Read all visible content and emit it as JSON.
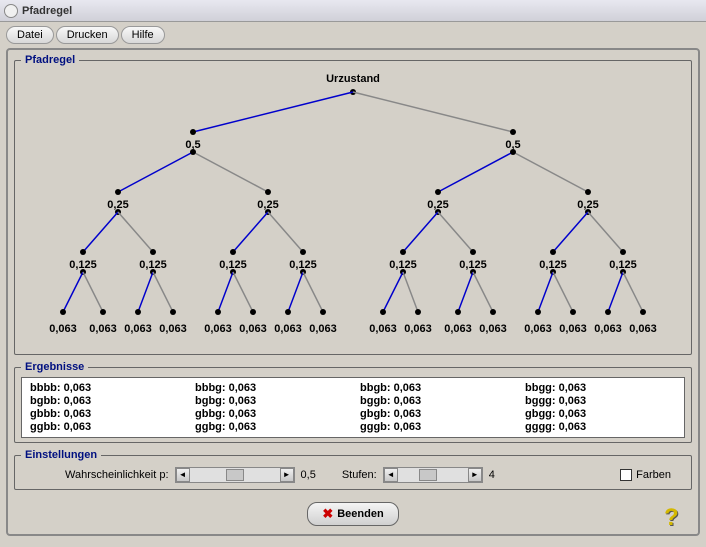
{
  "window": {
    "title": "Pfadregel"
  },
  "menu": {
    "datei": "Datei",
    "drucken": "Drucken",
    "hilfe": "Hilfe"
  },
  "frames": {
    "pfadregel": "Pfadregel",
    "ergebnisse": "Ergebnisse",
    "einstellungen": "Einstellungen"
  },
  "tree": {
    "root_label": "Urzustand",
    "level1": [
      "0,5",
      "0,5"
    ],
    "level2": [
      "0,25",
      "0,25",
      "0,25",
      "0,25"
    ],
    "level3": [
      "0,125",
      "0,125",
      "0,125",
      "0,125",
      "0,125",
      "0,125",
      "0,125",
      "0,125"
    ],
    "level4": [
      "0,063",
      "0,063",
      "0,063",
      "0,063",
      "0,063",
      "0,063",
      "0,063",
      "0,063",
      "0,063",
      "0,063",
      "0,063",
      "0,063",
      "0,063",
      "0,063",
      "0,063",
      "0,063"
    ]
  },
  "results": {
    "r0": "bbbb: 0,063",
    "r1": "bbbg: 0,063",
    "r2": "bbgb: 0,063",
    "r3": "bbgg: 0,063",
    "r4": "bgbb: 0,063",
    "r5": "bgbg: 0,063",
    "r6": "bggb: 0,063",
    "r7": "bggg: 0,063",
    "r8": "gbbb: 0,063",
    "r9": "gbbg: 0,063",
    "r10": "gbgb: 0,063",
    "r11": "gbgg: 0,063",
    "r12": "ggbb: 0,063",
    "r13": "ggbg: 0,063",
    "r14": "gggb: 0,063",
    "r15": "gggg: 0,063"
  },
  "settings": {
    "prob_label": "Wahrscheinlichkeit p:",
    "prob_value": "0,5",
    "stufen_label": "Stufen:",
    "stufen_value": "4",
    "farben_label": "Farben"
  },
  "buttons": {
    "beenden": "Beenden"
  }
}
